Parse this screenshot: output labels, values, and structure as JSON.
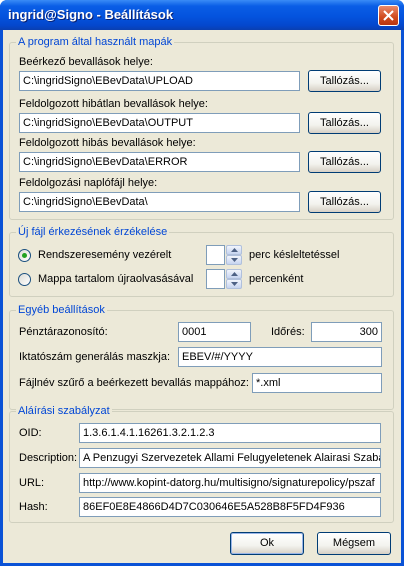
{
  "window": {
    "title": "ingrid@Signo - Beállítások"
  },
  "folders": {
    "legend": "A program által használt mapák",
    "incoming": {
      "label": "Beérkező bevallások helye:",
      "value": "C:\\ingridSigno\\EBevData\\UPLOAD",
      "browse": "Tallózás..."
    },
    "processed_ok": {
      "label": "Feldolgozott hibátlan bevallások helye:",
      "value": "C:\\ingridSigno\\EBevData\\OUTPUT",
      "browse": "Tallózás..."
    },
    "processed_err": {
      "label": "Feldolgozott hibás bevallások helye:",
      "value": "C:\\ingridSigno\\EBevData\\ERROR",
      "browse": "Tallózás..."
    },
    "logfile": {
      "label": "Feldolgozási naplófájl helye:",
      "value": "C:\\ingridSigno\\EBevData\\",
      "browse": "Tallózás..."
    }
  },
  "detection": {
    "legend": "Új fájl érkezésének érzékelése",
    "option_event": {
      "label": "Rendszeresemény vezérelt",
      "selected": true,
      "value": "",
      "unit": "perc késleltetéssel"
    },
    "option_rescan": {
      "label": "Mappa tartalom újraolvasásával",
      "selected": false,
      "value": "",
      "unit": "percenként"
    }
  },
  "other": {
    "legend": "Egyéb beállítások",
    "cashier_id": {
      "label": "Pénztárazonosító:",
      "value": "0001"
    },
    "timeout": {
      "label": "Időrés:",
      "value": "300"
    },
    "filing_mask": {
      "label": "Iktatószám generálás maszkja:",
      "value": "EBEV/#/YYYY"
    },
    "file_filter": {
      "label": "Fájlnév szűrő a beérkezett bevallás mappához:",
      "value": "*.xml"
    }
  },
  "signature": {
    "legend": "Aláírási szabályzat",
    "oid": {
      "label": "OID:",
      "value": "1.3.6.1.4.1.16261.3.2.1.2.3"
    },
    "description": {
      "label": "Description:",
      "value": "A Penzugyi Szervezetek Allami Felugyeletenek Alairasi Szabal"
    },
    "url": {
      "label": "URL:",
      "value": "http://www.kopint-datorg.hu/multisigno/signaturepolicy/pszaf"
    },
    "hash": {
      "label": "Hash:",
      "value": "86EF0E8E4866D4D7C030646E5A528B8F5FD4F936"
    }
  },
  "buttons": {
    "ok": "Ok",
    "cancel": "Mégsem"
  },
  "colors": {
    "title_bar": "#0453de",
    "group_legend": "#0046d5",
    "dialog_bg": "#ece9d8",
    "radio_dot": "#21a121",
    "close_button": "#d04a1d"
  }
}
